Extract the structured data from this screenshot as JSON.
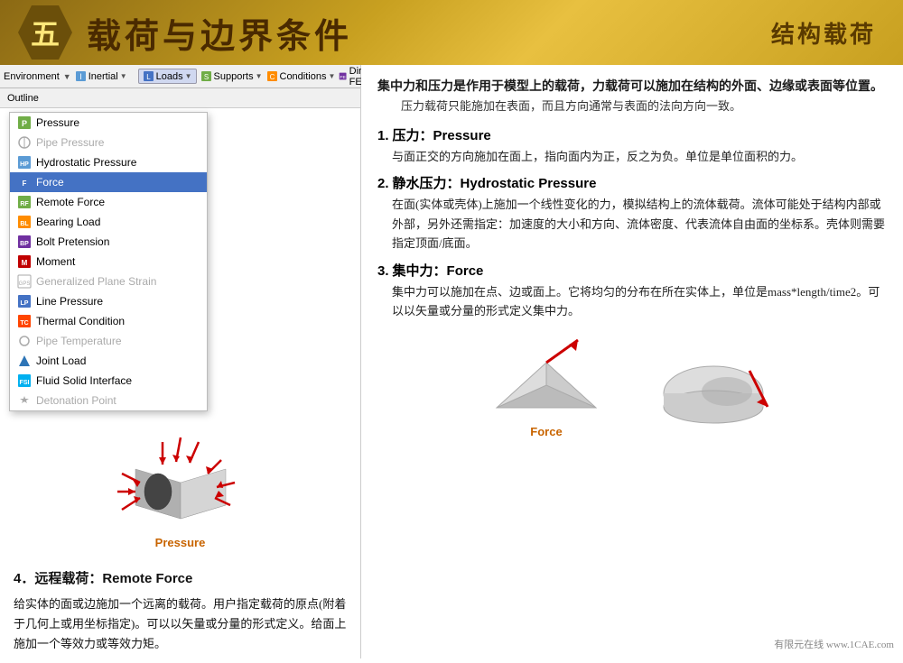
{
  "header": {
    "number": "五",
    "title": "载荷与边界条件",
    "subtitle": "结构载荷"
  },
  "toolbar": {
    "environment_label": "Environment",
    "inertial_label": "Inertial",
    "loads_label": "Loads",
    "supports_label": "Supports",
    "conditions_label": "Conditions",
    "direct_fe_label": "Direct FE",
    "outline_label": "Outline"
  },
  "menu": {
    "items": [
      {
        "label": "Pressure",
        "icon": "green-square",
        "selected": false,
        "dimmed": false
      },
      {
        "label": "Pipe Pressure",
        "icon": "gray-line",
        "selected": false,
        "dimmed": true
      },
      {
        "label": "Hydrostatic Pressure",
        "icon": "blue-wave",
        "selected": false,
        "dimmed": false
      },
      {
        "label": "Force",
        "icon": "blue-arrow",
        "selected": true,
        "dimmed": false
      },
      {
        "label": "Remote Force",
        "icon": "green-remote",
        "selected": false,
        "dimmed": false
      },
      {
        "label": "Bearing Load",
        "icon": "orange-bearing",
        "selected": false,
        "dimmed": false
      },
      {
        "label": "Bolt Pretension",
        "icon": "bolt-icon",
        "selected": false,
        "dimmed": false
      },
      {
        "label": "Moment",
        "icon": "moment-icon",
        "selected": false,
        "dimmed": false
      },
      {
        "label": "Generalized Plane Strain",
        "icon": "gps-icon",
        "selected": false,
        "dimmed": true
      },
      {
        "label": "Line Pressure",
        "icon": "line-pressure",
        "selected": false,
        "dimmed": false
      },
      {
        "label": "Thermal Condition",
        "icon": "thermal-icon",
        "selected": false,
        "dimmed": false
      },
      {
        "label": "Pipe Temperature",
        "icon": "pipe-temp",
        "selected": false,
        "dimmed": true
      },
      {
        "label": "Joint Load",
        "icon": "joint-icon",
        "selected": false,
        "dimmed": false
      },
      {
        "label": "Fluid Solid Interface",
        "icon": "fluid-icon",
        "selected": false,
        "dimmed": false
      },
      {
        "label": "Detonation Point",
        "icon": "detonation-icon",
        "selected": false,
        "dimmed": true
      }
    ]
  },
  "pressure_label": "Pressure",
  "force_label": "Force",
  "intro": {
    "bold_text": "集中力和压力是作用于模型上的载荷，力载荷可以施加在结构的外面、边缘或表面等位置。",
    "normal_text": "压力载荷只能施加在表面，而且方向通常与表面的法向方向一致。"
  },
  "sections": [
    {
      "number": "1.",
      "title": "压力：",
      "title_en": "Pressure",
      "body": "与面正交的方向施加在面上，指向面内为正，反之为负。单位是单位面积的力。"
    },
    {
      "number": "2.",
      "title": "静水压力：",
      "title_en": "Hydrostatic Pressure",
      "body": "在面(实体或壳体)上施加一个线性变化的力，模拟结构上的流体载荷。流体可能处于结构内部或外部，另外还需指定：加速度的大小和方向、流体密度、代表流体自由面的坐标系。壳体则需要指定顶面/底面。"
    },
    {
      "number": "3.",
      "title": "集中力：",
      "title_en": "Force",
      "body": "集中力可以施加在点、边或面上。它将均匀的分布在所在实体上，单位是mass*length/time2。可以以矢量或分量的形式定义集中力。"
    }
  ],
  "left_section": {
    "title": "4．远程载荷：Remote Force",
    "body": "给实体的面或边施加一个远离的载荷。用户指定载荷的原点(附着于几何上或用坐标指定)。可以以矢量或分量的形式定义。给面上施加一个等效力或等效力矩。"
  },
  "watermark": "有限元在线 www.1CAE.com"
}
